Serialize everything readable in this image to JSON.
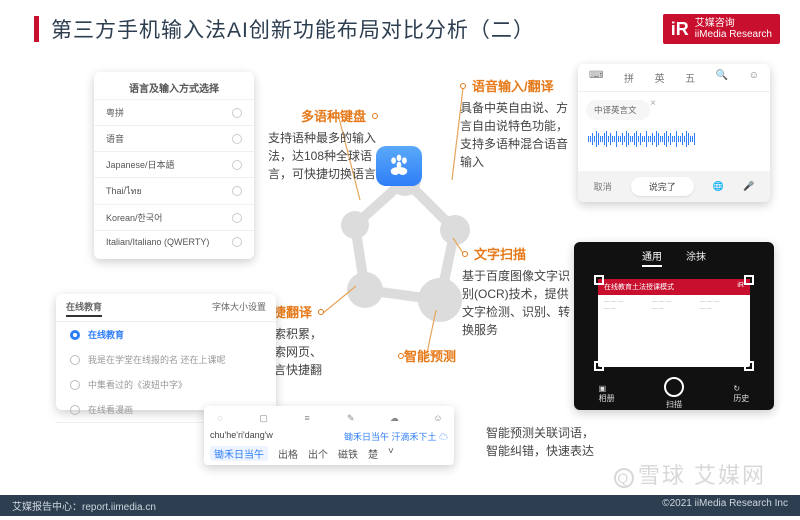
{
  "header": {
    "title": "第三方手机输入法AI创新功能布局对比分析（二）",
    "brand_cn": "艾媒咨询",
    "brand_en": "iiMedia Research"
  },
  "features": {
    "multilang": {
      "heading": "多语种键盘",
      "body": "支持语种最多的输入法，达108种全球语言，可快捷切换语言"
    },
    "voice": {
      "heading": "语音输入/翻译",
      "body": "具备中英自由说、方言自由说特色功能，支持多语种混合语音输入"
    },
    "search": {
      "heading": "搜索/快捷翻译",
      "body": "借助百度搜索积累，提供在线搜索网页、图片、多语言快捷翻译"
    },
    "ocr": {
      "heading": "文字扫描",
      "body": "基于百度图像文字识别(OCR)技术，提供文字检测、识别、转换服务"
    },
    "predict": {
      "heading": "智能预测"
    }
  },
  "smart_predict": {
    "line1": "智能预测关联词语，",
    "line2": "智能纠错，快速表达"
  },
  "lang_card": {
    "title": "语言及输入方式选择",
    "items": [
      "粤拼",
      "语音",
      "Japanese/日本語",
      "Thai/ไทย",
      "Korean/한국어",
      "Italian/Italiano (QWERTY)"
    ]
  },
  "search_card": {
    "tab_left": "在线教育",
    "tab_right": "字体大小设置",
    "items": [
      {
        "on": true,
        "text": "在线教育"
      },
      {
        "on": false,
        "text": "我是在学堂在线报的名 还在上课呢"
      },
      {
        "on": false,
        "text": "中集看过的《波妞中字》"
      },
      {
        "on": false,
        "text": "在线看漫画"
      }
    ]
  },
  "cand_card": {
    "pinyin": "chu'he'ri'dang'w",
    "best": "锄禾日当午 汗滴禾下土",
    "cands": [
      "锄禾日当午",
      "出格",
      "出个",
      "磁铁",
      "楚"
    ]
  },
  "voice_card": {
    "tabs": [
      "拼",
      "英",
      "五"
    ],
    "bubble": "中译英言文",
    "cancel": "取消",
    "done": "说完了"
  },
  "scan_card": {
    "tab1": "通用",
    "tab2": "涂抹",
    "doc_title": "在线教育土法授课模式",
    "icon_left": "相册",
    "icon_mid": "扫描",
    "icon_right": "历史"
  },
  "footer": {
    "left": "艾媒报告中心：report.iimedia.cn",
    "right": "©2021 iiMedia Research Inc"
  },
  "watermark": "雪球 艾媒网"
}
